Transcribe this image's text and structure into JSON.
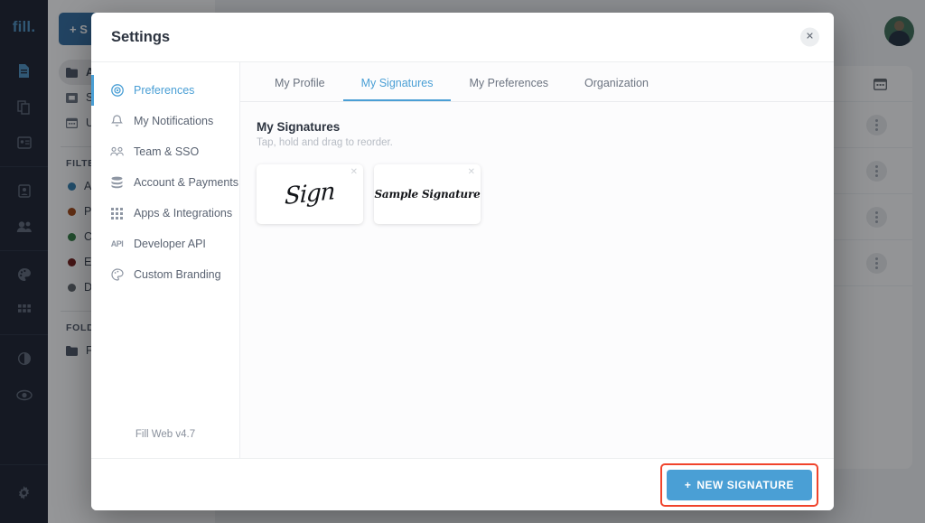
{
  "background": {
    "brand": "fill.",
    "nav_icons": [
      {
        "name": "document-icon",
        "glyph": "Ὄ4",
        "active": true
      },
      {
        "name": "copy-document-icon",
        "active": false
      },
      {
        "name": "id-card-icon",
        "active": false
      },
      {
        "name": "contact-card-icon",
        "active": false
      },
      {
        "name": "team-icon",
        "active": false
      },
      {
        "name": "palette-icon",
        "active": false
      },
      {
        "name": "apps-grid-icon",
        "active": false
      },
      {
        "name": "contrast-icon",
        "active": false
      },
      {
        "name": "eye-icon",
        "active": false
      }
    ],
    "settings_icon": "gear-icon",
    "new_button_label": "+ S",
    "nav_rows": [
      {
        "label": "A",
        "icon": "folder-icon",
        "selected": true
      },
      {
        "label": "S",
        "icon": "inbox-icon",
        "selected": false
      },
      {
        "label": "U",
        "icon": "calendar-icon",
        "selected": false
      }
    ],
    "filters_label": "FILTE",
    "filters": [
      {
        "label": "A",
        "color": "#2e7cae"
      },
      {
        "label": "P",
        "color": "#a0430f"
      },
      {
        "label": "C",
        "color": "#2f7a3e"
      },
      {
        "label": "E",
        "color": "#6d1713"
      },
      {
        "label": "D",
        "color": "#5d6369"
      }
    ],
    "folders_label": "FOLD",
    "folders": [
      {
        "label": "F",
        "icon": "folder-icon"
      }
    ],
    "table_header_icon": "calendar-icon",
    "table_rows": 4,
    "row_menu_icon": "kebab-menu-icon",
    "avatar": "user-avatar"
  },
  "modal": {
    "title": "Settings",
    "close_icon": "close-icon",
    "version": "Fill Web v4.7",
    "sidebar": [
      {
        "label": "Preferences",
        "icon": "preferences-icon",
        "active": true
      },
      {
        "label": "My Notifications",
        "icon": "bell-icon",
        "active": false
      },
      {
        "label": "Team & SSO",
        "icon": "team-icon",
        "active": false
      },
      {
        "label": "Account & Payments",
        "icon": "payments-icon",
        "active": false
      },
      {
        "label": "Apps & Integrations",
        "icon": "apps-grid-icon",
        "active": false
      },
      {
        "label": "Developer API",
        "icon": "api-icon",
        "active": false
      },
      {
        "label": "Custom Branding",
        "icon": "palette-icon",
        "active": false
      }
    ],
    "tabs": [
      {
        "label": "My Profile",
        "active": false
      },
      {
        "label": "My Signatures",
        "active": true
      },
      {
        "label": "My Preferences",
        "active": false
      },
      {
        "label": "Organization",
        "active": false
      }
    ],
    "pane": {
      "title": "My Signatures",
      "subtitle": "Tap, hold and drag to reorder.",
      "signatures": [
        {
          "text": "Sign",
          "style": "scrawl",
          "delete_icon": "close-icon"
        },
        {
          "text": "Sample Signature",
          "style": "script",
          "delete_icon": "close-icon"
        }
      ]
    },
    "footer": {
      "new_signature_label": "NEW SIGNATURE",
      "new_signature_plus": "+",
      "highlight_color": "#f0442c",
      "accent_color": "#4a9fd5"
    }
  }
}
